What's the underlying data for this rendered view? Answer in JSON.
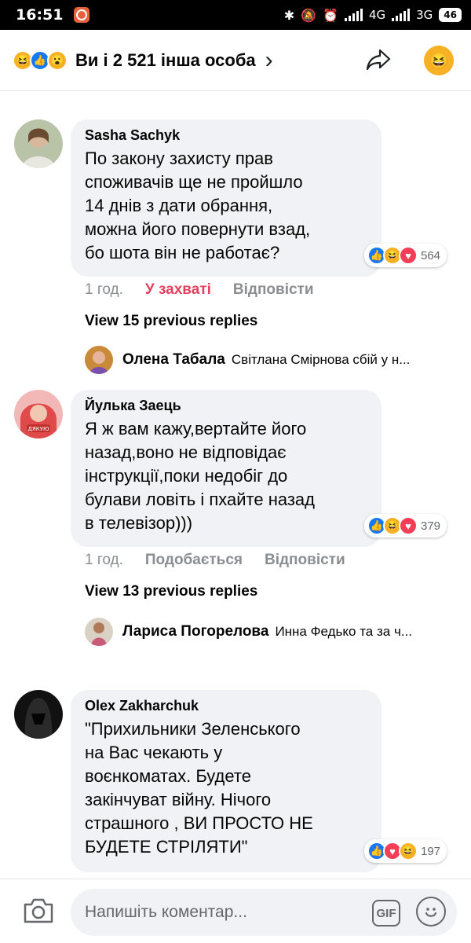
{
  "status_bar": {
    "time": "16:51",
    "net1": "4G",
    "net2": "3G",
    "battery": "46"
  },
  "header": {
    "title": "Ви і 2 521 інша особа"
  },
  "colors": {
    "like": "#1877f2",
    "love": "#f33e58",
    "haha": "#f7b125",
    "bubble": "#f0f2f5",
    "accent_liked": "#e4405f"
  },
  "comments": [
    {
      "author": "Sasha Sachyk",
      "text": "По закону захисту прав\nспоживачів ще не пройшло\n14 днів з дати обрання,\nможна його повернути взад,\nбо шота він не работає?",
      "reactions": [
        "like-icon",
        "haha-icon",
        "love-icon"
      ],
      "reaction_count": "564",
      "time": "1 год.",
      "like_label": "У захваті",
      "reply_label": "Відповісти",
      "view_previous": "View 15 previous replies",
      "last_reply": {
        "name": "Олена Табала",
        "text": "Світлана Смірнова сбій у н..."
      }
    },
    {
      "author": "Йулька Заець",
      "avatar_caption": "ДЯКУЮ",
      "text": "Я ж вам кажу,вертайте його\nназад,воно не відповідає\nінструкції,поки недобіг до\nбулави ловіть і пхайте назад\nв телевізор)))",
      "reactions": [
        "like-icon",
        "haha-icon",
        "love-icon"
      ],
      "reaction_count": "379",
      "time": "1 год.",
      "like_label": "Подобається",
      "reply_label": "Відповісти",
      "view_previous": "View 13 previous replies",
      "last_reply": {
        "name": "Лариса Погорелова",
        "text": "Инна Федько та за ч..."
      }
    },
    {
      "author": "Olex Zakharchuk",
      "text": "\"Прихильники Зеленського\nна Вас чекають у\nвоєнкоматах. Будете\nзакінчуват війну. Нічого\nстрашного , ВИ ПРОСТО НЕ\nБУДЕТЕ СТРІЛЯТИ\"",
      "reactions": [
        "like-icon",
        "love-icon",
        "haha-icon"
      ],
      "reaction_count": "197"
    }
  ],
  "composer": {
    "placeholder": "Напишіть коментар...",
    "gif_label": "GIF"
  }
}
